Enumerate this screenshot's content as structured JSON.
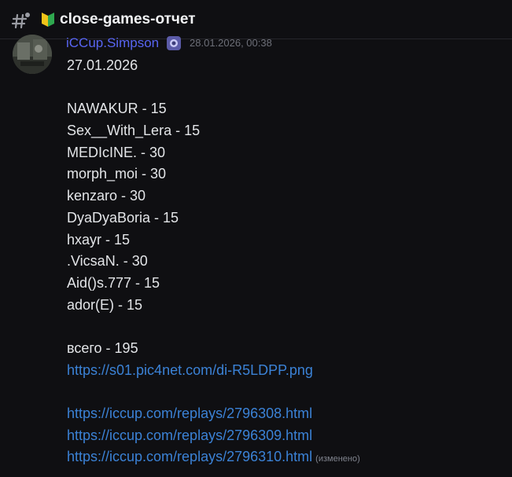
{
  "header": {
    "channel_name": "close-games-отчет"
  },
  "message": {
    "author": "iCCup.Simpson",
    "timestamp": "28.01.2026, 00:38",
    "lines": [
      "27.01.2026",
      "",
      "NAWAKUR - 15",
      "Sex__With_Lera - 15",
      "MEDIcINE. - 30",
      "morph_moi - 30",
      "kenzaro - 30",
      "DyaDyaBoria - 15",
      "hxayr - 15",
      ".VicsaN. - 30",
      "Aid()s.777 - 15",
      "ador(E) - 15",
      "",
      "всего - 195"
    ],
    "image_link": "https://s01.pic4net.com/di-R5LDPP.png",
    "replay_links": [
      "https://iccup.com/replays/2796308.html",
      "https://iccup.com/replays/2796309.html",
      "https://iccup.com/replays/2796310.html"
    ],
    "edited_label": "(изменено)"
  },
  "icons": {
    "channel_type": "forum-hash-icon",
    "channel_badge": "beginner-leaf-icon",
    "role": "role-badge-icon",
    "avatar": "user-avatar"
  },
  "colors": {
    "background": "#0f0f12",
    "author": "#5865f2",
    "link": "#3b82d6",
    "text": "#e3e5e8"
  }
}
